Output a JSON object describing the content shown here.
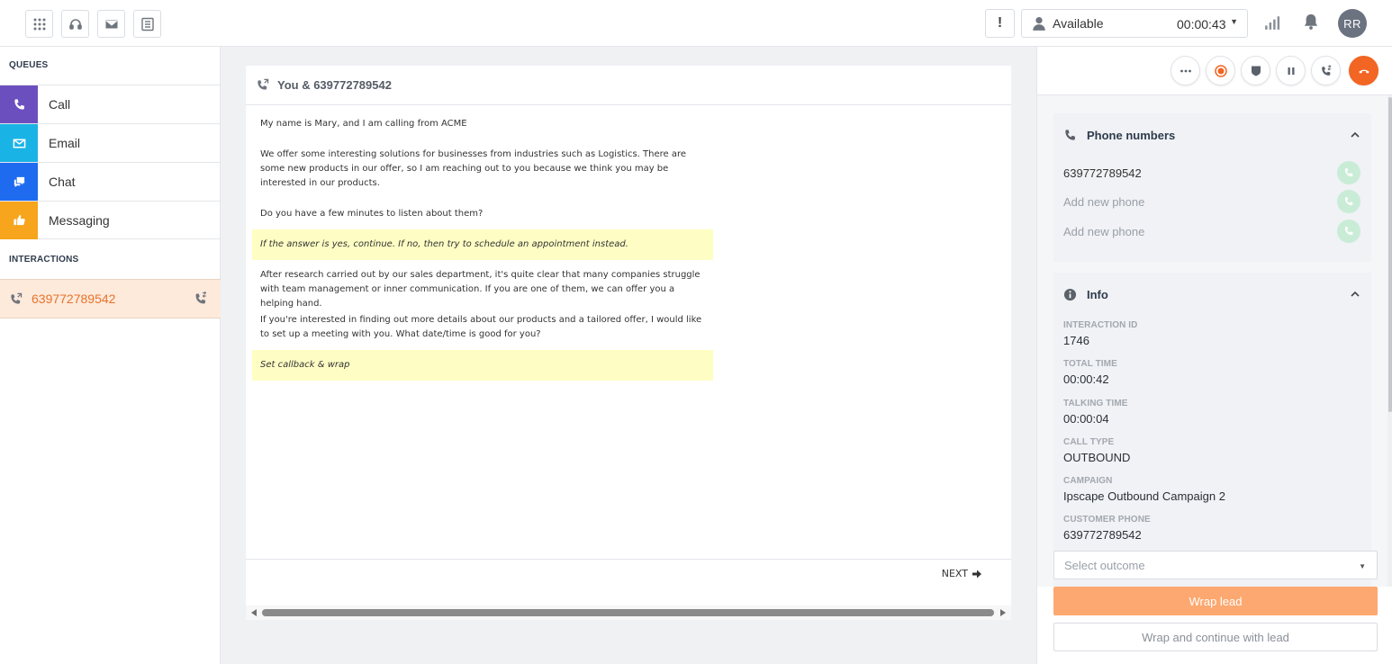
{
  "topbar": {
    "nav_icons": [
      "apps-grid-icon",
      "headset-icon",
      "mail-icon",
      "list-icon"
    ],
    "alert_label": "!",
    "status": {
      "label": "Available",
      "timer": "00:00:43"
    },
    "avatar_initials": "RR"
  },
  "sidebar": {
    "queues_title": "QUEUES",
    "queues": [
      {
        "label": "Call",
        "icon": "phone-icon",
        "color": "#6c4fbf"
      },
      {
        "label": "Email",
        "icon": "mail-icon",
        "color": "#1ab3e6"
      },
      {
        "label": "Chat",
        "icon": "chat-icon",
        "color": "#1e6bf0"
      },
      {
        "label": "Messaging",
        "icon": "thumbs-up-icon",
        "color": "#f7a51c"
      }
    ],
    "interactions_title": "INTERACTIONS",
    "interaction": {
      "phone": "639772789542"
    }
  },
  "script": {
    "title": "You & 639772789542",
    "paragraphs": [
      "My name is Mary, and I am calling from ACME",
      "We offer some interesting solutions for businesses from industries such as Logistics. There are some new products in our offer, so I am reaching out to you because we think you may be interested in our products.",
      "Do you have a few minutes to listen about them?",
      "After research carried out by our sales department, it's quite clear that many companies struggle with team management or inner communication. If you are one of them, we can offer you a helping hand.",
      "If you're interested in finding out more details about our products and a tailored offer, I would like to set up a meeting with you. What date/time is good for you?"
    ],
    "notes": [
      "If the answer is yes, continue. If no, then try to schedule an appointment instead.",
      "Set callback & wrap"
    ],
    "next_label": "NEXT"
  },
  "right": {
    "controls": [
      "more-icon",
      "record-icon",
      "shield-icon",
      "pause-icon",
      "transfer-icon",
      "hangup-icon"
    ],
    "phones": {
      "title": "Phone numbers",
      "rows": [
        "639772789542",
        "Add new phone",
        "Add new phone"
      ]
    },
    "info": {
      "title": "Info",
      "fields": [
        {
          "label": "INTERACTION ID",
          "value": "1746"
        },
        {
          "label": "TOTAL TIME",
          "value": "00:00:42"
        },
        {
          "label": "TALKING TIME",
          "value": "00:00:04"
        },
        {
          "label": "CALL TYPE",
          "value": "OUTBOUND"
        },
        {
          "label": "CAMPAIGN",
          "value": "Ipscape Outbound Campaign 2"
        },
        {
          "label": "CUSTOMER PHONE",
          "value": "639772789542"
        }
      ]
    },
    "outcome_placeholder": "Select outcome",
    "wrap_lead_label": "Wrap lead",
    "wrap_continue_label": "Wrap and continue with lead",
    "hangup_color": "#f26522",
    "accent_color": "#fca870"
  }
}
